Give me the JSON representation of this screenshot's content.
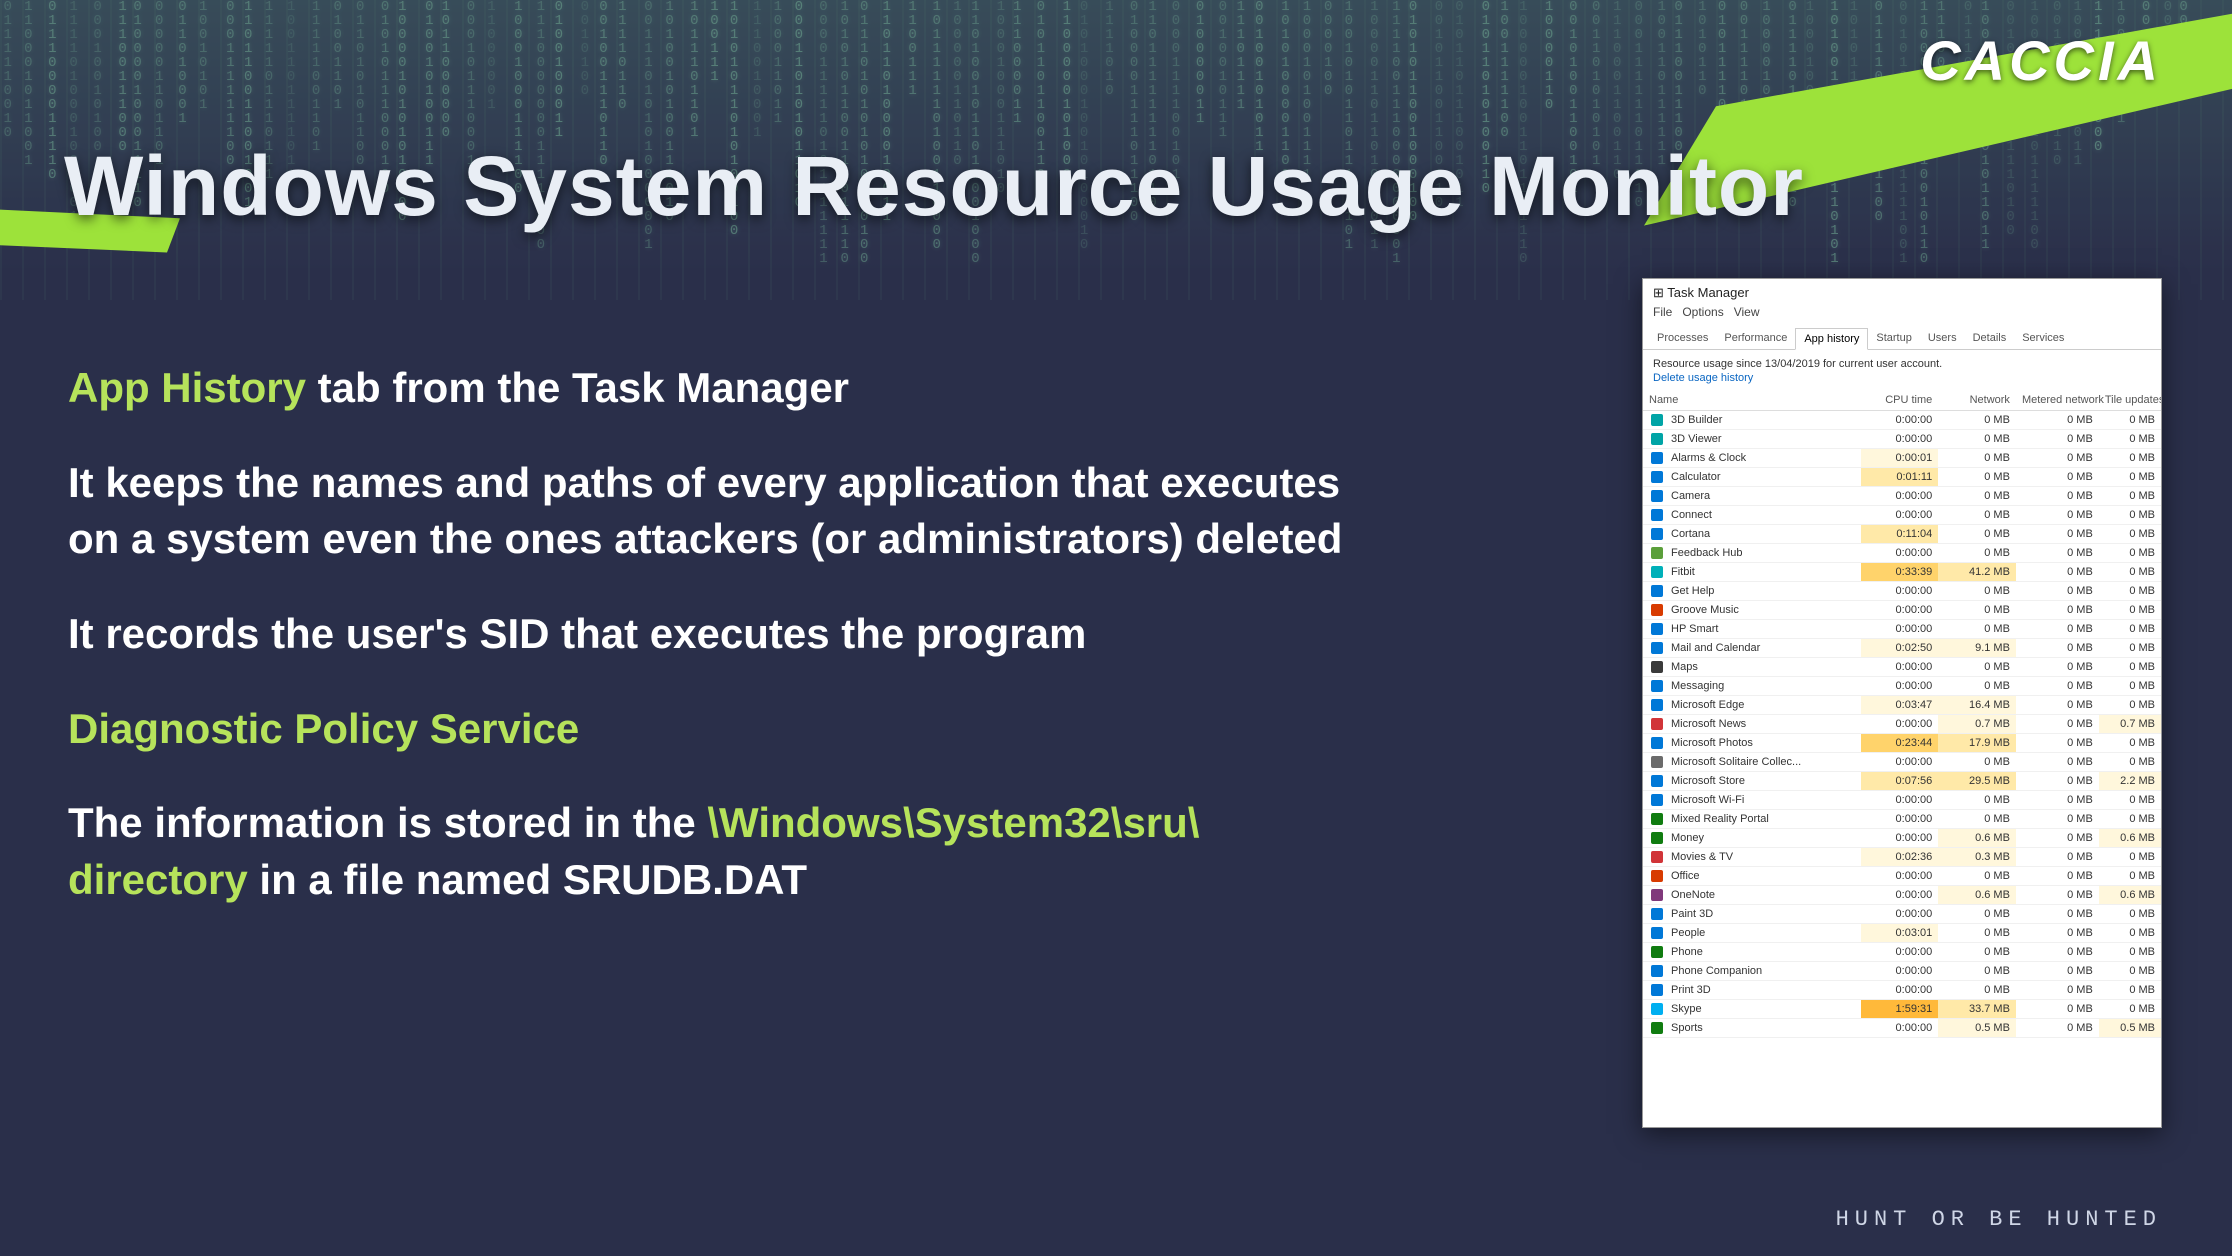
{
  "logo": "CACCIA",
  "title": "Windows System Resource Usage Monitor",
  "bullets": {
    "b1_accent": "App History",
    "b1_rest": " tab from the Task Manager",
    "b2": "It keeps the names and paths of every application that executes on a system even the ones attackers (or administrators) deleted",
    "b3": "It records the user's SID that executes the program",
    "b4_accent": "Diagnostic Policy Service",
    "b5_lead": "The information is stored in the ",
    "b5_accent": "\\Windows\\System32\\sru\\ directory",
    "b5_mid": " in a file named ",
    "b5_bold": "SRUDB.DAT"
  },
  "tagline": "HUNT OR BE HUNTED",
  "task_manager": {
    "window_title": "Task Manager",
    "menus": [
      "File",
      "Options",
      "View"
    ],
    "tabs": [
      "Processes",
      "Performance",
      "App history",
      "Startup",
      "Users",
      "Details",
      "Services"
    ],
    "active_tab": "App history",
    "info_line": "Resource usage since 13/04/2019 for current user account.",
    "delete_link": "Delete usage history",
    "columns": [
      "Name",
      "CPU time",
      "Network",
      "Metered network",
      "Tile updates"
    ],
    "rows": [
      {
        "name": "3D Builder",
        "icon": "#00a4a6",
        "cpu": "0:00:00",
        "cpu_h": 0,
        "net": "0 MB",
        "net_h": 0,
        "met": "0 MB",
        "met_h": 0,
        "tile": "0 MB",
        "tile_h": 0
      },
      {
        "name": "3D Viewer",
        "icon": "#00a4a6",
        "cpu": "0:00:00",
        "cpu_h": 0,
        "net": "0 MB",
        "net_h": 0,
        "met": "0 MB",
        "met_h": 0,
        "tile": "0 MB",
        "tile_h": 0
      },
      {
        "name": "Alarms & Clock",
        "icon": "#0078d7",
        "cpu": "0:00:01",
        "cpu_h": 1,
        "net": "0 MB",
        "net_h": 0,
        "met": "0 MB",
        "met_h": 0,
        "tile": "0 MB",
        "tile_h": 0
      },
      {
        "name": "Calculator",
        "icon": "#0078d7",
        "cpu": "0:01:11",
        "cpu_h": 2,
        "net": "0 MB",
        "net_h": 0,
        "met": "0 MB",
        "met_h": 0,
        "tile": "0 MB",
        "tile_h": 0
      },
      {
        "name": "Camera",
        "icon": "#0078d7",
        "cpu": "0:00:00",
        "cpu_h": 0,
        "net": "0 MB",
        "net_h": 0,
        "met": "0 MB",
        "met_h": 0,
        "tile": "0 MB",
        "tile_h": 0
      },
      {
        "name": "Connect",
        "icon": "#0078d7",
        "cpu": "0:00:00",
        "cpu_h": 0,
        "net": "0 MB",
        "net_h": 0,
        "met": "0 MB",
        "met_h": 0,
        "tile": "0 MB",
        "tile_h": 0
      },
      {
        "name": "Cortana",
        "icon": "#0078d7",
        "cpu": "0:11:04",
        "cpu_h": 2,
        "net": "0 MB",
        "net_h": 0,
        "met": "0 MB",
        "met_h": 0,
        "tile": "0 MB",
        "tile_h": 0
      },
      {
        "name": "Feedback Hub",
        "icon": "#5b9f3a",
        "cpu": "0:00:00",
        "cpu_h": 0,
        "net": "0 MB",
        "net_h": 0,
        "met": "0 MB",
        "met_h": 0,
        "tile": "0 MB",
        "tile_h": 0
      },
      {
        "name": "Fitbit",
        "icon": "#00b0b9",
        "cpu": "0:33:39",
        "cpu_h": 3,
        "net": "41.2 MB",
        "net_h": 2,
        "met": "0 MB",
        "met_h": 0,
        "tile": "0 MB",
        "tile_h": 0
      },
      {
        "name": "Get Help",
        "icon": "#0078d7",
        "cpu": "0:00:00",
        "cpu_h": 0,
        "net": "0 MB",
        "net_h": 0,
        "met": "0 MB",
        "met_h": 0,
        "tile": "0 MB",
        "tile_h": 0
      },
      {
        "name": "Groove Music",
        "icon": "#d83b01",
        "cpu": "0:00:00",
        "cpu_h": 0,
        "net": "0 MB",
        "net_h": 0,
        "met": "0 MB",
        "met_h": 0,
        "tile": "0 MB",
        "tile_h": 0
      },
      {
        "name": "HP Smart",
        "icon": "#0078d7",
        "cpu": "0:00:00",
        "cpu_h": 0,
        "net": "0 MB",
        "net_h": 0,
        "met": "0 MB",
        "met_h": 0,
        "tile": "0 MB",
        "tile_h": 0
      },
      {
        "name": "Mail and Calendar",
        "icon": "#0078d7",
        "cpu": "0:02:50",
        "cpu_h": 1,
        "net": "9.1 MB",
        "net_h": 1,
        "met": "0 MB",
        "met_h": 0,
        "tile": "0 MB",
        "tile_h": 0
      },
      {
        "name": "Maps",
        "icon": "#3a3a3a",
        "cpu": "0:00:00",
        "cpu_h": 0,
        "net": "0 MB",
        "net_h": 0,
        "met": "0 MB",
        "met_h": 0,
        "tile": "0 MB",
        "tile_h": 0
      },
      {
        "name": "Messaging",
        "icon": "#0078d7",
        "cpu": "0:00:00",
        "cpu_h": 0,
        "net": "0 MB",
        "net_h": 0,
        "met": "0 MB",
        "met_h": 0,
        "tile": "0 MB",
        "tile_h": 0
      },
      {
        "name": "Microsoft Edge",
        "icon": "#0078d7",
        "cpu": "0:03:47",
        "cpu_h": 1,
        "net": "16.4 MB",
        "net_h": 1,
        "met": "0 MB",
        "met_h": 0,
        "tile": "0 MB",
        "tile_h": 0
      },
      {
        "name": "Microsoft News",
        "icon": "#d13438",
        "cpu": "0:00:00",
        "cpu_h": 0,
        "net": "0.7 MB",
        "net_h": 1,
        "met": "0 MB",
        "met_h": 0,
        "tile": "0.7 MB",
        "tile_h": 1
      },
      {
        "name": "Microsoft Photos",
        "icon": "#0078d7",
        "cpu": "0:23:44",
        "cpu_h": 3,
        "net": "17.9 MB",
        "net_h": 2,
        "met": "0 MB",
        "met_h": 0,
        "tile": "0 MB",
        "tile_h": 0
      },
      {
        "name": "Microsoft Solitaire Collec...",
        "icon": "#6b6b6b",
        "cpu": "0:00:00",
        "cpu_h": 0,
        "net": "0 MB",
        "net_h": 0,
        "met": "0 MB",
        "met_h": 0,
        "tile": "0 MB",
        "tile_h": 0
      },
      {
        "name": "Microsoft Store",
        "icon": "#0078d7",
        "cpu": "0:07:56",
        "cpu_h": 2,
        "net": "29.5 MB",
        "net_h": 2,
        "met": "0 MB",
        "met_h": 0,
        "tile": "2.2 MB",
        "tile_h": 1
      },
      {
        "name": "Microsoft Wi-Fi",
        "icon": "#0078d7",
        "cpu": "0:00:00",
        "cpu_h": 0,
        "net": "0 MB",
        "net_h": 0,
        "met": "0 MB",
        "met_h": 0,
        "tile": "0 MB",
        "tile_h": 0
      },
      {
        "name": "Mixed Reality Portal",
        "icon": "#107c10",
        "cpu": "0:00:00",
        "cpu_h": 0,
        "net": "0 MB",
        "net_h": 0,
        "met": "0 MB",
        "met_h": 0,
        "tile": "0 MB",
        "tile_h": 0
      },
      {
        "name": "Money",
        "icon": "#107c10",
        "cpu": "0:00:00",
        "cpu_h": 0,
        "net": "0.6 MB",
        "net_h": 1,
        "met": "0 MB",
        "met_h": 0,
        "tile": "0.6 MB",
        "tile_h": 1
      },
      {
        "name": "Movies & TV",
        "icon": "#d13438",
        "cpu": "0:02:36",
        "cpu_h": 1,
        "net": "0.3 MB",
        "net_h": 1,
        "met": "0 MB",
        "met_h": 0,
        "tile": "0 MB",
        "tile_h": 0
      },
      {
        "name": "Office",
        "icon": "#d83b01",
        "cpu": "0:00:00",
        "cpu_h": 0,
        "net": "0 MB",
        "net_h": 0,
        "met": "0 MB",
        "met_h": 0,
        "tile": "0 MB",
        "tile_h": 0
      },
      {
        "name": "OneNote",
        "icon": "#80397b",
        "cpu": "0:00:00",
        "cpu_h": 0,
        "net": "0.6 MB",
        "net_h": 1,
        "met": "0 MB",
        "met_h": 0,
        "tile": "0.6 MB",
        "tile_h": 1
      },
      {
        "name": "Paint 3D",
        "icon": "#0078d7",
        "cpu": "0:00:00",
        "cpu_h": 0,
        "net": "0 MB",
        "net_h": 0,
        "met": "0 MB",
        "met_h": 0,
        "tile": "0 MB",
        "tile_h": 0
      },
      {
        "name": "People",
        "icon": "#0078d7",
        "cpu": "0:03:01",
        "cpu_h": 1,
        "net": "0 MB",
        "net_h": 0,
        "met": "0 MB",
        "met_h": 0,
        "tile": "0 MB",
        "tile_h": 0
      },
      {
        "name": "Phone",
        "icon": "#107c10",
        "cpu": "0:00:00",
        "cpu_h": 0,
        "net": "0 MB",
        "net_h": 0,
        "met": "0 MB",
        "met_h": 0,
        "tile": "0 MB",
        "tile_h": 0
      },
      {
        "name": "Phone Companion",
        "icon": "#0078d7",
        "cpu": "0:00:00",
        "cpu_h": 0,
        "net": "0 MB",
        "net_h": 0,
        "met": "0 MB",
        "met_h": 0,
        "tile": "0 MB",
        "tile_h": 0
      },
      {
        "name": "Print 3D",
        "icon": "#0078d7",
        "cpu": "0:00:00",
        "cpu_h": 0,
        "net": "0 MB",
        "net_h": 0,
        "met": "0 MB",
        "met_h": 0,
        "tile": "0 MB",
        "tile_h": 0
      },
      {
        "name": "Skype",
        "icon": "#00aff0",
        "cpu": "1:59:31",
        "cpu_h": 4,
        "net": "33.7 MB",
        "net_h": 2,
        "met": "0 MB",
        "met_h": 0,
        "tile": "0 MB",
        "tile_h": 0
      },
      {
        "name": "Sports",
        "icon": "#107c10",
        "cpu": "0:00:00",
        "cpu_h": 0,
        "net": "0.5 MB",
        "net_h": 1,
        "met": "0 MB",
        "met_h": 0,
        "tile": "0.5 MB",
        "tile_h": 1
      }
    ]
  }
}
